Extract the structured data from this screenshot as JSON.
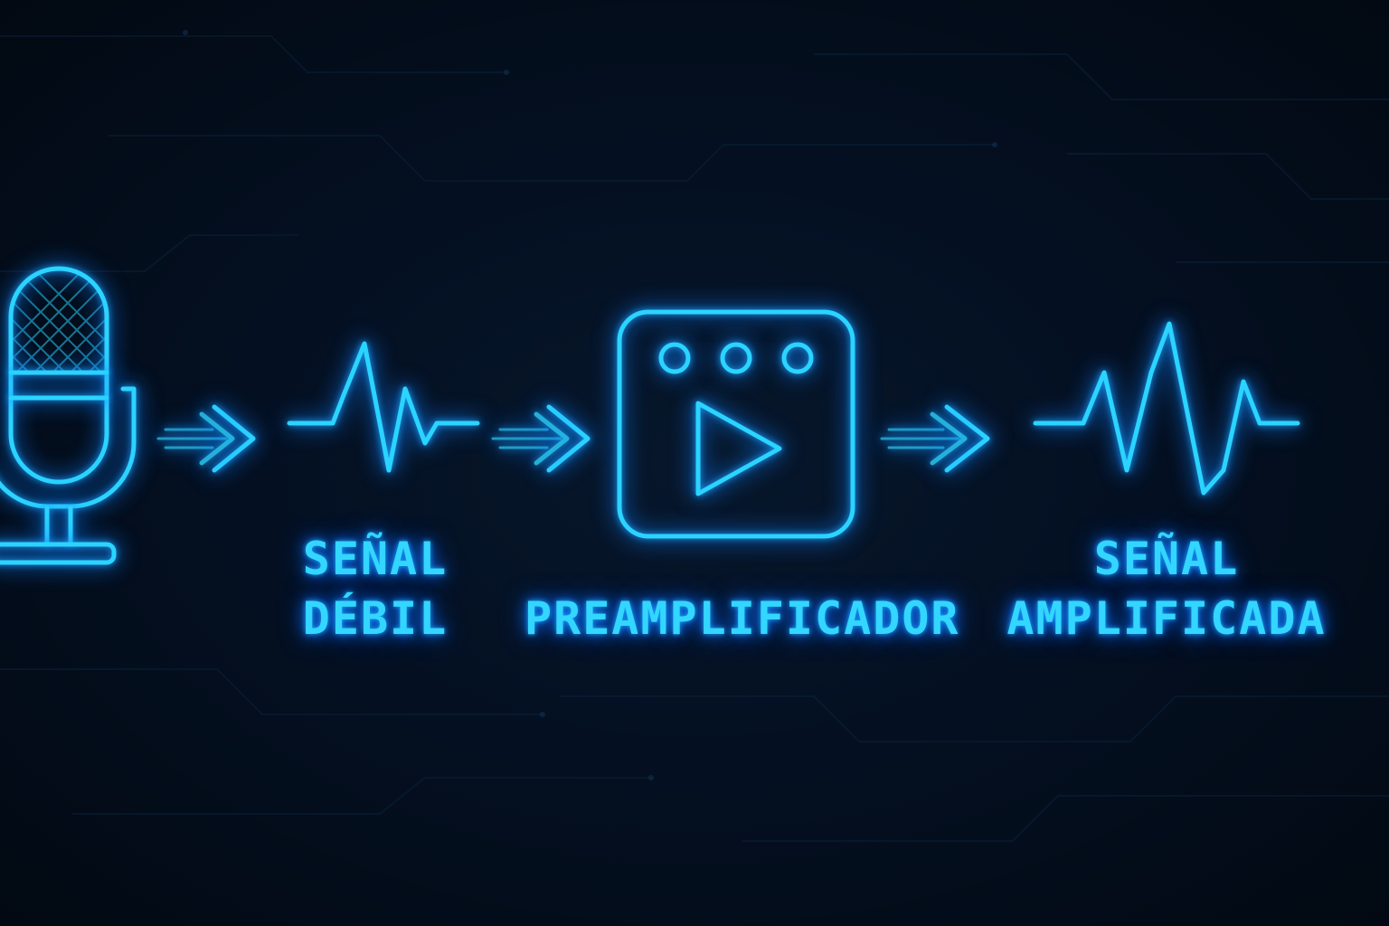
{
  "accent_color": "#2bd4ff",
  "background_color": "#030b17",
  "nodes": [
    {
      "icon": "microphone-icon"
    },
    {
      "icon": "weak-waveform-icon",
      "label_lines": [
        "SEÑAL",
        "DÉBIL"
      ]
    },
    {
      "icon": "preamplifier-play-icon",
      "label_lines": [
        "PREAMPLIFICADOR"
      ]
    },
    {
      "icon": "amplified-waveform-icon",
      "label_lines": [
        "SEÑAL",
        "AMPLIFICADA"
      ]
    }
  ],
  "connectors": [
    "double-chevron-arrow-icon",
    "double-chevron-arrow-icon",
    "double-chevron-arrow-icon"
  ]
}
